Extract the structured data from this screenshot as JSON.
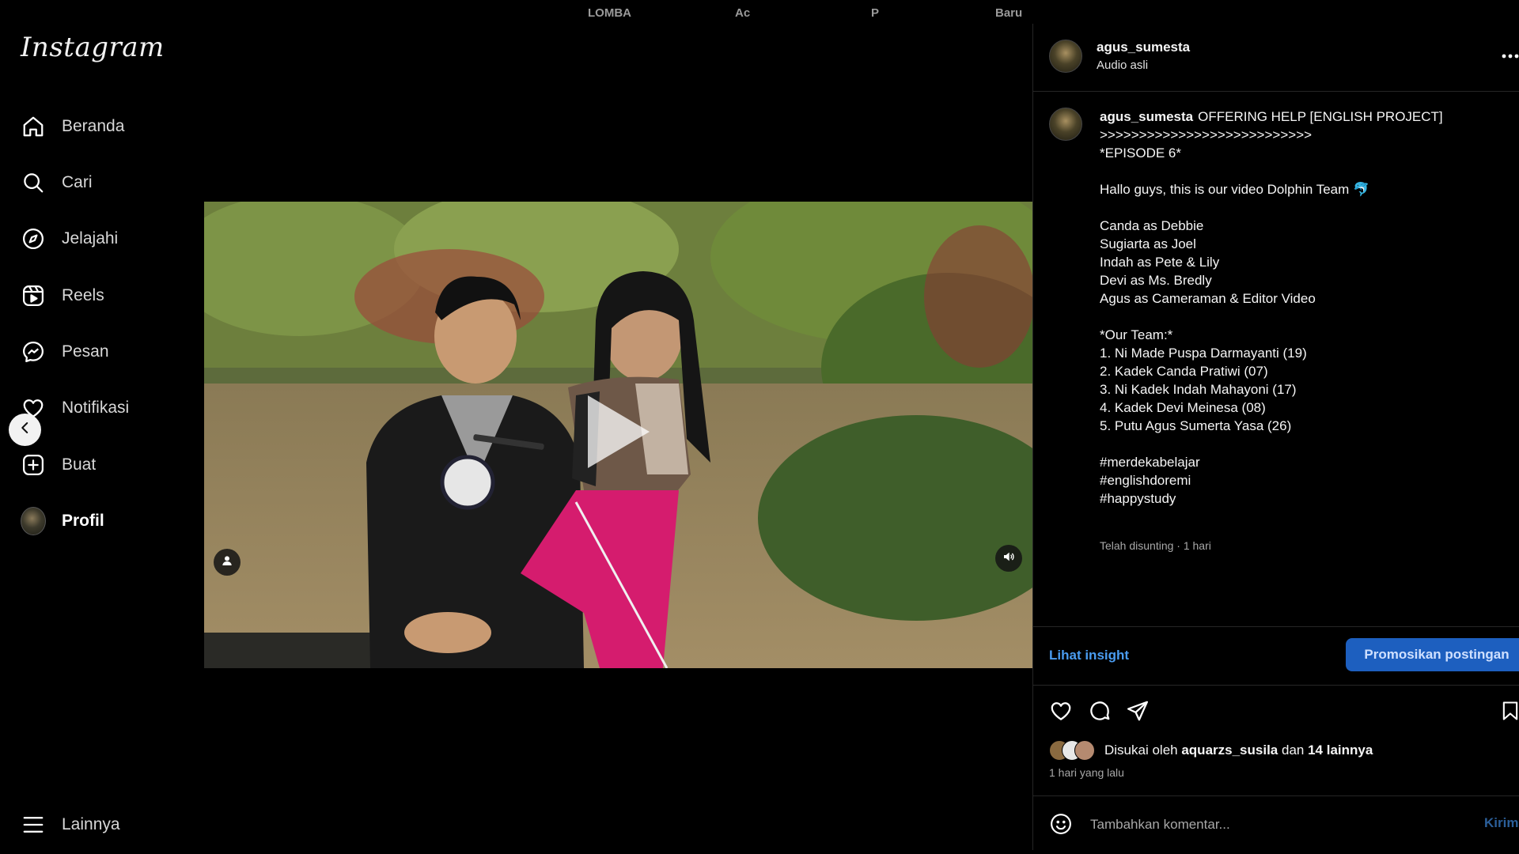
{
  "app": {
    "logo": "Instagram"
  },
  "top_tabs": [
    "LOMBA",
    "Ac",
    "P",
    "Baru"
  ],
  "sidebar": {
    "items": [
      {
        "label": "Beranda",
        "icon": "home-icon"
      },
      {
        "label": "Cari",
        "icon": "search-icon"
      },
      {
        "label": "Jelajahi",
        "icon": "compass-icon"
      },
      {
        "label": "Reels",
        "icon": "reels-icon"
      },
      {
        "label": "Pesan",
        "icon": "messenger-icon"
      },
      {
        "label": "Notifikasi",
        "icon": "heart-icon"
      },
      {
        "label": "Buat",
        "icon": "create-icon"
      },
      {
        "label": "Profil",
        "icon": "avatar"
      }
    ],
    "more": {
      "label": "Lainnya",
      "icon": "hamburger-icon"
    }
  },
  "post": {
    "username": "agus_sumesta",
    "audio": "Audio asli",
    "caption_title": "OFFERING HELP [ENGLISH PROJECT]",
    "caption_body": ">>>>>>>>>>>>>>>>>>>>>>>>>>>\n*EPISODE 6*\n\nHallo guys, this is our video Dolphin Team 🐬\n\nCanda as Debbie\nSugiarta as Joel\nIndah as Pete & Lily\nDevi as Ms. Bredly\nAgus as Cameraman & Editor Video\n\n*Our Team:*\n1. Ni Made Puspa Darmayanti (19)\n2. Kadek Canda Pratiwi (07)\n3. Ni Kadek Indah Mahayoni (17)\n4. Kadek Devi Meinesa (08)\n5. Putu Agus Sumerta Yasa (26)\n\n#merdekabelajar\n#englishdoremi\n#happystudy",
    "edited": "Telah disunting · 1 hari",
    "insight_label": "Lihat insight",
    "promote_label": "Promosikan postingan",
    "likes": {
      "prefix": "Disukai oleh",
      "user": "aquarzs_susila",
      "joiner": "dan",
      "others": "14 lainnya"
    },
    "time_ago": "1 hari yang lalu",
    "comment_placeholder": "Tambahkan komentar...",
    "send_label": "Kirim"
  },
  "colors": {
    "accent": "#4a9cf0",
    "promote_bg": "#1d5fbf",
    "panel_border": "#262626"
  }
}
